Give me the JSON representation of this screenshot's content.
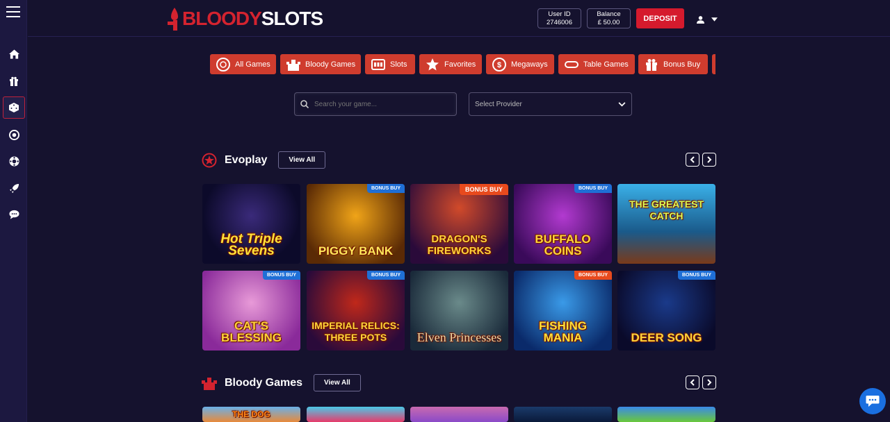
{
  "brand": {
    "part1": "BLOODY",
    "part2": "SLOTS"
  },
  "header": {
    "user_id_label": "User ID",
    "user_id_value": "2746006",
    "balance_label": "Balance",
    "balance_value": "£ 50.00",
    "deposit_label": "DEPOSIT"
  },
  "categories": [
    {
      "label": "All Games",
      "icon": "chip-icon"
    },
    {
      "label": "Bloody Games",
      "icon": "castle-icon"
    },
    {
      "label": "Slots",
      "icon": "slot-machine-icon"
    },
    {
      "label": "Favorites",
      "icon": "star-icon"
    },
    {
      "label": "Megaways",
      "icon": "coin-icon"
    },
    {
      "label": "Table Games",
      "icon": "table-icon"
    },
    {
      "label": "Bonus Buy",
      "icon": "gift-icon"
    }
  ],
  "search": {
    "placeholder": "Search your game..."
  },
  "provider": {
    "label": "Select Provider"
  },
  "sections": [
    {
      "title": "Evoplay",
      "view_all": "View All"
    },
    {
      "title": "Bloody Games",
      "view_all": "View All"
    }
  ],
  "games_row1": [
    {
      "name": "Hot Triple Sevens",
      "badge": ""
    },
    {
      "name": "PIGGY BANK",
      "badge": "BONUS BUY"
    },
    {
      "name": "DRAGON'S FIREWORKS",
      "badge": "BONUS BUY"
    },
    {
      "name": "BUFFALO COINS",
      "badge": "BONUS BUY"
    },
    {
      "name": "THE GREATEST CATCH",
      "badge": ""
    }
  ],
  "games_row2": [
    {
      "name": "CAT'S BLESSING",
      "badge": "BONUS BUY"
    },
    {
      "name": "IMPERIAL RELICS: THREE POTS",
      "badge": "BONUS BUY"
    },
    {
      "name": "Elven Princesses",
      "badge": ""
    },
    {
      "name": "FISHING MANIA",
      "badge": "BONUS BUY"
    },
    {
      "name": "DEER SONG",
      "badge": "BONUS BUY"
    }
  ],
  "games_row3": [
    {
      "name": "THE DOG"
    },
    {
      "name": ""
    },
    {
      "name": ""
    },
    {
      "name": ""
    },
    {
      "name": ""
    }
  ]
}
